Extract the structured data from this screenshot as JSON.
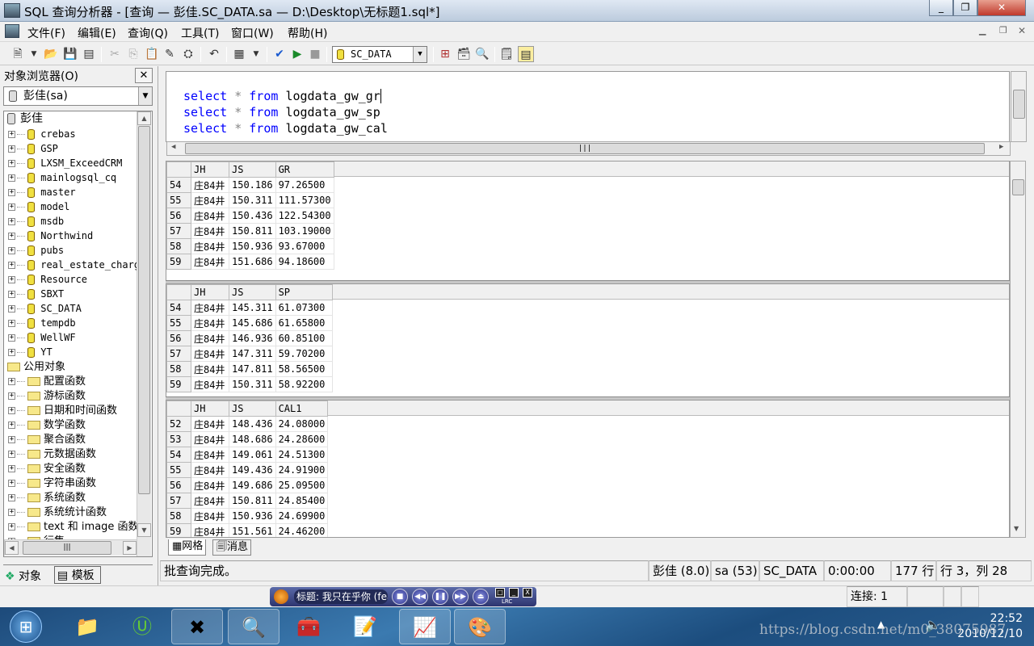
{
  "window": {
    "title": "SQL 查询分析器 - [查询 — 彭佳.SC_DATA.sa — D:\\Desktop\\无标题1.sql*]"
  },
  "menu": [
    "文件(F)",
    "编辑(E)",
    "查询(Q)",
    "工具(T)",
    "窗口(W)",
    "帮助(H)"
  ],
  "toolbar": {
    "database": "SC_DATA",
    "icons": [
      "new-query-icon",
      "dropdown-icon",
      "open-icon",
      "save-icon",
      "load-script-icon",
      "cut-icon",
      "copy-icon",
      "paste-icon",
      "clear-icon",
      "find-icon",
      "undo-icon",
      "results-grid-icon",
      "dropdown-icon",
      "parse-check-icon",
      "execute-icon",
      "stop-icon",
      "execution-plan-icon",
      "object-browser-icon",
      "object-search-icon",
      "properties-icon",
      "results-pane-icon"
    ]
  },
  "object_browser": {
    "title": "对象浏览器(O)",
    "server_combo": "彭佳(sa)",
    "root": "彭佳",
    "databases": [
      "crebas",
      "GSP",
      "LXSM_ExceedCRM",
      "mainlogsql_cq",
      "master",
      "model",
      "msdb",
      "Northwind",
      "pubs",
      "real_estate_charg",
      "Resource",
      "SBXT",
      "SC_DATA",
      "tempdb",
      "WellWF",
      "YT"
    ],
    "common_objects": "公用对象",
    "functions": [
      "配置函数",
      "游标函数",
      "日期和时间函数",
      "数学函数",
      "聚合函数",
      "元数据函数",
      "安全函数",
      "字符串函数",
      "系统函数",
      "系统统计函数",
      "text 和 image 函数",
      "行集"
    ],
    "tabs": [
      "对象",
      "模板"
    ]
  },
  "editor": {
    "lines": [
      {
        "kw1": "select",
        "op": "*",
        "kw2": "from",
        "table": "logdata_gw_gr"
      },
      {
        "kw1": "select",
        "op": "*",
        "kw2": "from",
        "table": "logdata_gw_sp"
      },
      {
        "kw1": "select",
        "op": "*",
        "kw2": "from",
        "table": "logdata_gw_cal"
      }
    ]
  },
  "results": [
    {
      "columns": [
        "JH",
        "JS",
        "GR"
      ],
      "rows": [
        [
          "54",
          "庄84井",
          "150.186",
          "97.26500"
        ],
        [
          "55",
          "庄84井",
          "150.311",
          "111.57300"
        ],
        [
          "56",
          "庄84井",
          "150.436",
          "122.54300"
        ],
        [
          "57",
          "庄84井",
          "150.811",
          "103.19000"
        ],
        [
          "58",
          "庄84井",
          "150.936",
          "93.67000"
        ],
        [
          "59",
          "庄84井",
          "151.686",
          "94.18600"
        ]
      ]
    },
    {
      "columns": [
        "JH",
        "JS",
        "SP"
      ],
      "rows": [
        [
          "54",
          "庄84井",
          "145.311",
          "61.07300"
        ],
        [
          "55",
          "庄84井",
          "145.686",
          "61.65800"
        ],
        [
          "56",
          "庄84井",
          "146.936",
          "60.85100"
        ],
        [
          "57",
          "庄84井",
          "147.311",
          "59.70200"
        ],
        [
          "58",
          "庄84井",
          "147.811",
          "58.56500"
        ],
        [
          "59",
          "庄84井",
          "150.311",
          "58.92200"
        ]
      ]
    },
    {
      "columns": [
        "JH",
        "JS",
        "CAL1"
      ],
      "rows": [
        [
          "52",
          "庄84井",
          "148.436",
          "24.08000"
        ],
        [
          "53",
          "庄84井",
          "148.686",
          "24.28600"
        ],
        [
          "54",
          "庄84井",
          "149.061",
          "24.51300"
        ],
        [
          "55",
          "庄84井",
          "149.436",
          "24.91900"
        ],
        [
          "56",
          "庄84井",
          "149.686",
          "25.09500"
        ],
        [
          "57",
          "庄84井",
          "150.811",
          "24.85400"
        ],
        [
          "58",
          "庄84井",
          "150.936",
          "24.69900"
        ],
        [
          "59",
          "庄84井",
          "151.561",
          "24.46200"
        ]
      ]
    }
  ],
  "result_tabs": [
    "网格",
    "消息"
  ],
  "status": {
    "message": "批查询完成。",
    "server": "彭佳 (8.0)",
    "user": "sa (53)",
    "database": "SC_DATA",
    "elapsed": "0:00:00",
    "rows": "177 行",
    "position": "行 3，列 28"
  },
  "bottom": {
    "connections": "连接: 1"
  },
  "player": {
    "title": "标题: 我只在乎你 (fea",
    "lrc": "LRC"
  },
  "taskbar": {
    "time": "22:52",
    "date": "2010/12/10",
    "watermark": "https://blog.csdn.net/m0_38075987"
  }
}
